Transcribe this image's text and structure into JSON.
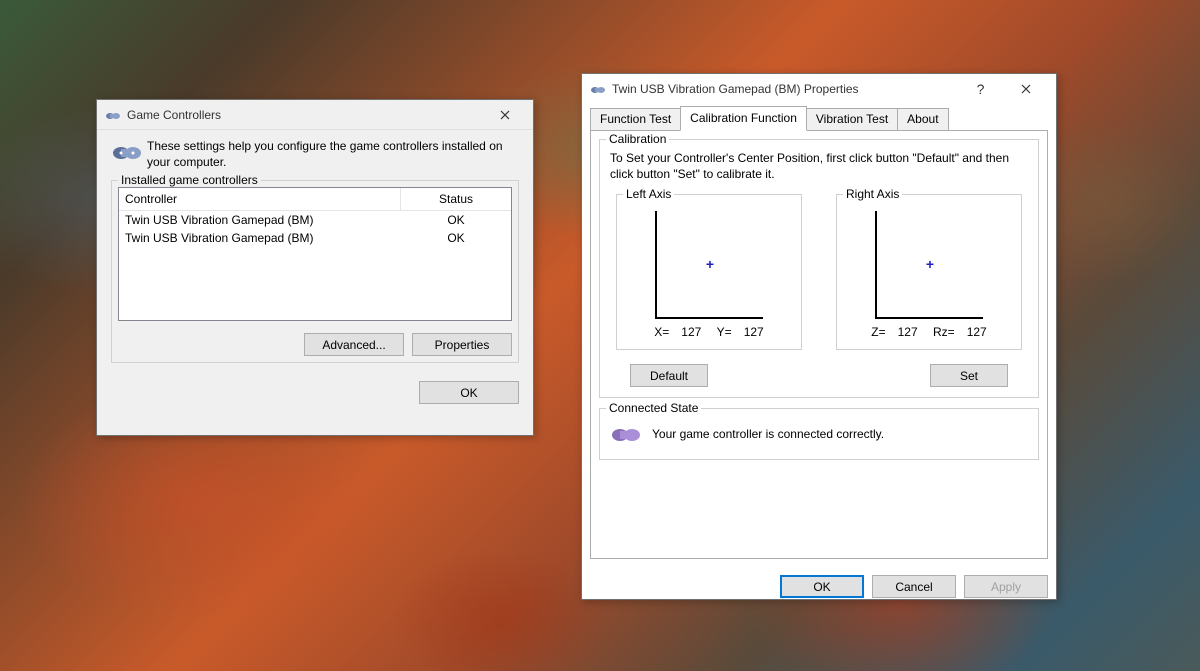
{
  "window1": {
    "title": "Game Controllers",
    "intro": "These settings help you configure the game controllers installed on your computer.",
    "group_label": "Installed game controllers",
    "columns": {
      "controller": "Controller",
      "status": "Status"
    },
    "rows": [
      {
        "name": "Twin USB Vibration Gamepad (BM)",
        "status": "OK"
      },
      {
        "name": "Twin USB Vibration Gamepad (BM)",
        "status": "OK"
      }
    ],
    "buttons": {
      "advanced": "Advanced...",
      "properties": "Properties",
      "ok": "OK"
    }
  },
  "window2": {
    "title": "Twin USB Vibration Gamepad (BM) Properties",
    "tabs": [
      "Function Test",
      "Calibration Function",
      "Vibration Test",
      "About"
    ],
    "active_tab": 1,
    "calibration": {
      "legend": "Calibration",
      "text": "To Set your Controller's  Center Position, first click button \"Default\" and then click button \"Set\" to calibrate it.",
      "left": {
        "legend": "Left Axis",
        "x_label": "X=",
        "y_label": "Y=",
        "x": "127",
        "y": "127"
      },
      "right": {
        "legend": "Right Axis",
        "z_label": "Z=",
        "rz_label": "Rz=",
        "z": "127",
        "rz": "127"
      },
      "buttons": {
        "default": "Default",
        "set": "Set"
      }
    },
    "connected": {
      "legend": "Connected State",
      "text": "Your game controller is connected correctly."
    },
    "footer": {
      "ok": "OK",
      "cancel": "Cancel",
      "apply": "Apply"
    }
  }
}
